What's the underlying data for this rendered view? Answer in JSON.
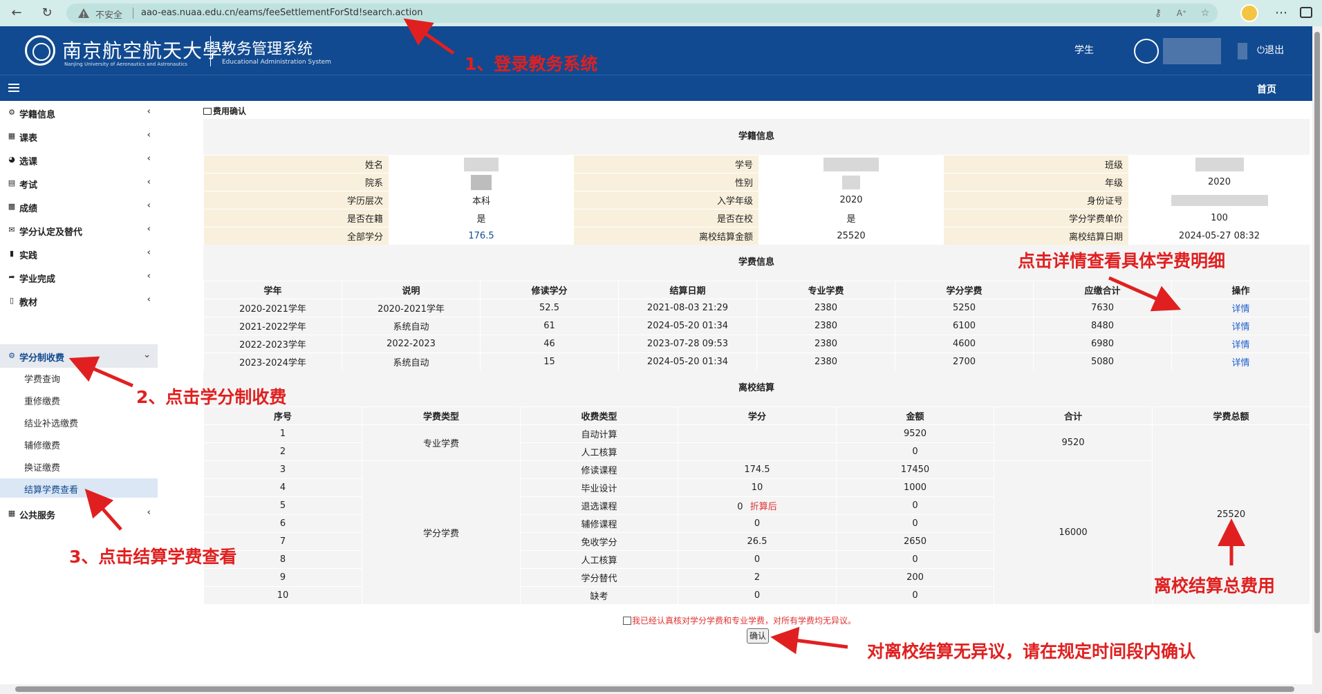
{
  "browser": {
    "insecure_label": "不安全",
    "url": "aao-eas.nuaa.edu.cn/eams/feeSettlementForStd!search.action"
  },
  "header": {
    "school_cn": "南京航空航天大學",
    "school_en": "Nanjing University of Aeronautics and Astronautics",
    "system_cn": "教务管理系统",
    "system_en": "Educational Administration System",
    "role": "学生",
    "logout": "退出",
    "home": "首页"
  },
  "sidebar": {
    "items": [
      {
        "icon": "dashboard-icon",
        "label": "学籍信息"
      },
      {
        "icon": "grid-icon",
        "label": "课表"
      },
      {
        "icon": "pie-icon",
        "label": "选课"
      },
      {
        "icon": "list-icon",
        "label": "考试"
      },
      {
        "icon": "calendar-icon",
        "label": "成绩"
      },
      {
        "icon": "mail-icon",
        "label": "学分认定及替代"
      },
      {
        "icon": "folder-icon",
        "label": "实践"
      },
      {
        "icon": "share-icon",
        "label": "学业完成"
      },
      {
        "icon": "book-icon",
        "label": "教材"
      },
      {
        "icon": "dashboard-icon",
        "label": "学分制收费"
      },
      {
        "icon": "grid-icon",
        "label": "公共服务"
      }
    ],
    "subitems": [
      "学费查询",
      "重修缴费",
      "结业补选缴费",
      "辅修缴费",
      "换证缴费",
      "结算学费查看"
    ]
  },
  "page": {
    "breadcrumb": "费用确认",
    "student_section_title": "学籍信息",
    "fee_section_title": "学费信息",
    "settle_section_title": "离校结算",
    "agree_text": "我已经认真核对学分学费和专业学费，对所有学费均无异议。",
    "confirm_label": "确认"
  },
  "student": {
    "labels": {
      "name": "姓名",
      "student_id": "学号",
      "class": "班级",
      "department": "院系",
      "gender": "性别",
      "grade": "年级",
      "level": "学历层次",
      "enroll_year": "入学年级",
      "id_card": "身份证号",
      "enrolled": "是否在籍",
      "on_campus": "是否在校",
      "credit_price": "学分学费单价",
      "total_credits": "全部学分",
      "settle_amount": "离校结算金额",
      "settle_date": "离校结算日期"
    },
    "values": {
      "grade": "2020",
      "level": "本科",
      "enroll_year": "2020",
      "enrolled": "是",
      "on_campus": "是",
      "credit_price": "100",
      "total_credits": "176.5",
      "settle_amount": "25520",
      "settle_date": "2024-05-27 08:32"
    }
  },
  "fee_table": {
    "headers": [
      "学年",
      "说明",
      "修读学分",
      "结算日期",
      "专业学费",
      "学分学费",
      "应缴合计",
      "操作"
    ],
    "rows": [
      [
        "2020-2021学年",
        "2020-2021学年",
        "52.5",
        "2021-08-03 21:29",
        "2380",
        "5250",
        "7630",
        "详情"
      ],
      [
        "2021-2022学年",
        "系统自动",
        "61",
        "2024-05-20 01:34",
        "2380",
        "6100",
        "8480",
        "详情"
      ],
      [
        "2022-2023学年",
        "2022-2023",
        "46",
        "2023-07-28 09:53",
        "2380",
        "4600",
        "6980",
        "详情"
      ],
      [
        "2023-2024学年",
        "系统自动",
        "15",
        "2024-05-20 01:34",
        "2380",
        "2700",
        "5080",
        "详情"
      ]
    ]
  },
  "settle_table": {
    "headers": [
      "序号",
      "学费类型",
      "收费类型",
      "学分",
      "金额",
      "合计",
      "学费总额"
    ],
    "type_professional": "专业学费",
    "type_credit": "学分学费",
    "subtotal_professional": "9520",
    "subtotal_credit": "16000",
    "grand_total": "25520",
    "discount_note": "折算后",
    "rows": [
      [
        "1",
        "自动计算",
        "",
        "9520"
      ],
      [
        "2",
        "人工核算",
        "",
        "0"
      ],
      [
        "3",
        "修读课程",
        "174.5",
        "17450"
      ],
      [
        "4",
        "毕业设计",
        "10",
        "1000"
      ],
      [
        "5",
        "退选课程",
        "0",
        "0"
      ],
      [
        "6",
        "辅修课程",
        "0",
        "0"
      ],
      [
        "7",
        "免收学分",
        "26.5",
        "2650"
      ],
      [
        "8",
        "人工核算",
        "0",
        "0"
      ],
      [
        "9",
        "学分替代",
        "2",
        "200"
      ],
      [
        "10",
        "缺考",
        "0",
        "0"
      ]
    ]
  },
  "annotations": {
    "step1": "1、登录教务系统",
    "step2": "2、点击学分制收费",
    "step3": "3、点击结算学费查看",
    "details_hint": "点击详情查看具体学费明细",
    "total_hint": "离校结算总费用",
    "confirm_hint": "对离校结算无异议，请在规定时间段内确认",
    "color": "#e02020"
  }
}
